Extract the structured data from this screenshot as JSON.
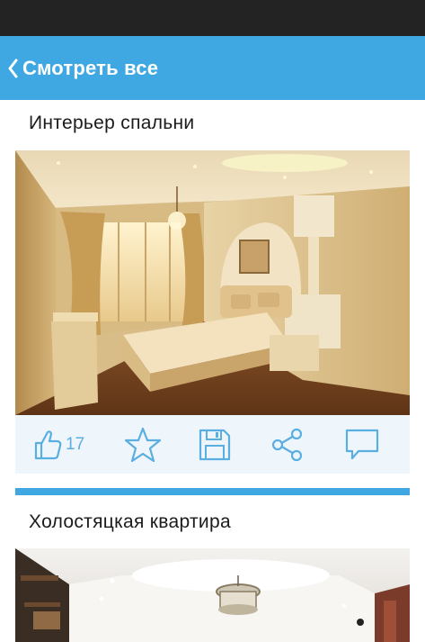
{
  "header": {
    "back_label": "Смотреть все"
  },
  "posts": [
    {
      "title": "Интерьер спальни",
      "image_icon": "bedroom-photo",
      "actions": {
        "likes_count": "17",
        "like_icon": "thumbs-up-icon",
        "favorite_icon": "star-icon",
        "save_icon": "floppy-disk-icon",
        "share_icon": "share-icon",
        "comment_icon": "speech-bubble-icon"
      }
    },
    {
      "title": "Холостяцкая квартира",
      "image_icon": "living-room-photo"
    }
  ],
  "colors": {
    "accent": "#3fa8e3",
    "status_bar": "#232323",
    "action_bar_bg": "#eef6fb",
    "icon": "#5aaee0"
  }
}
